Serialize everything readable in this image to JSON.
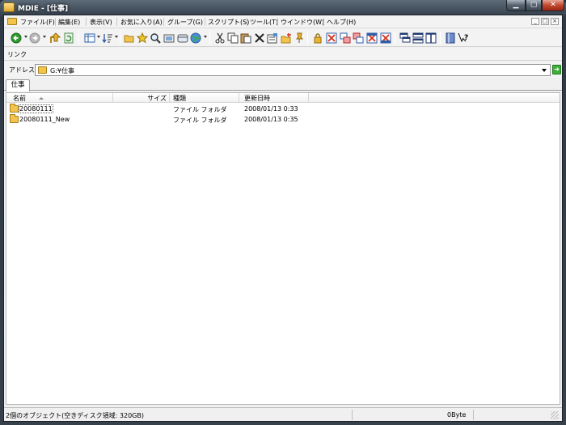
{
  "window": {
    "title": "MDIE - [仕事]"
  },
  "caption_buttons": {
    "minimize": "▁",
    "maximize": "▢",
    "close": "✕"
  },
  "menu": [
    "ファイル(F)",
    "編集(E)",
    "表示(V)",
    "お気に入り(A)",
    "グループ(G)",
    "スクリプト(S)",
    "ツール(T)",
    "ウインドウ(W)",
    "ヘルプ(H)"
  ],
  "mdi_controls": {
    "minimize": "_",
    "restore": "□",
    "close": "×"
  },
  "links_bar": {
    "label": "リンク"
  },
  "address_bar": {
    "label": "アドレス",
    "value": "G:¥仕事"
  },
  "tabs": [
    {
      "label": "仕事",
      "active": true
    }
  ],
  "list": {
    "columns": [
      "名前",
      "サイズ",
      "種類",
      "更新日時"
    ],
    "rows": [
      {
        "name": "20080111",
        "size": "",
        "type": "ファイル フォルダ",
        "modified": "2008/01/13 0:33"
      },
      {
        "name": "20080111_New",
        "size": "",
        "type": "ファイル フォルダ",
        "modified": "2008/01/13 0:35"
      }
    ]
  },
  "status": {
    "text": "2個のオブジェクト(空きディスク領域: 320GB)",
    "size": "0Byte"
  },
  "toolbar_icons": [
    "back-icon",
    "forward-icon",
    "up-icon",
    "refresh-icon",
    "view-icon",
    "sort-icon",
    "folder-open-icon",
    "favorites-icon",
    "search-icon",
    "image-icon",
    "window-icon",
    "web-icon",
    "cut-icon",
    "copy-icon",
    "paste-icon",
    "delete-icon",
    "properties-icon",
    "new-folder-icon",
    "pin-icon",
    "lock-icon",
    "close-window-icon",
    "cascade-icon",
    "tile-icon",
    "close-all-icon",
    "minimize-all-icon",
    "split-vertical-icon",
    "split-horizontal-icon",
    "columns-icon",
    "book-icon",
    "help-icon"
  ]
}
